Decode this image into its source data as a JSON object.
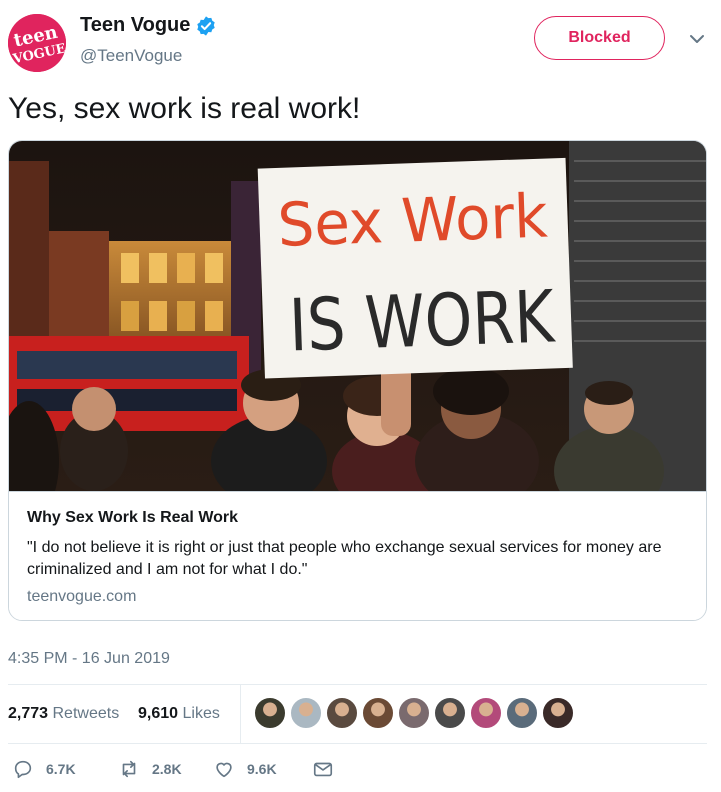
{
  "account": {
    "display_name": "Teen Vogue",
    "handle": "@TeenVogue",
    "avatar_text_top": "teen",
    "avatar_text_bottom": "VOGUE",
    "verified_icon": "verified-badge-icon",
    "brand_color": "#e0245e"
  },
  "follow_button": {
    "label": "Blocked"
  },
  "tweet": {
    "text": "Yes, sex work is real work!",
    "timestamp": "4:35 PM - 16 Jun 2019"
  },
  "card": {
    "sign_line1": "Sex Work",
    "sign_line2": "IS WORK",
    "title": "Why Sex Work Is Real Work",
    "description": "\"I do not believe it is right or just that people who exchange sexual services for money are criminalized and I am not for what I do.\"",
    "domain": "teenvogue.com"
  },
  "stats": {
    "retweets_count": "2,773",
    "retweets_label": "Retweets",
    "likes_count": "9,610",
    "likes_label": "Likes",
    "liker_colors": [
      "#3b3b2e",
      "#aab8c2",
      "#5a4a3f",
      "#6b4a35",
      "#7a6a6e",
      "#4a4a4a",
      "#b34a7a",
      "#5a6b7a",
      "#3a2a28"
    ]
  },
  "actions": {
    "reply_count": "6.7K",
    "retweet_count": "2.8K",
    "like_count": "9.6K"
  },
  "colors": {
    "text_primary": "#14171a",
    "text_secondary": "#657786",
    "verified_blue": "#1da1f2",
    "blocked_red": "#e0245e"
  }
}
